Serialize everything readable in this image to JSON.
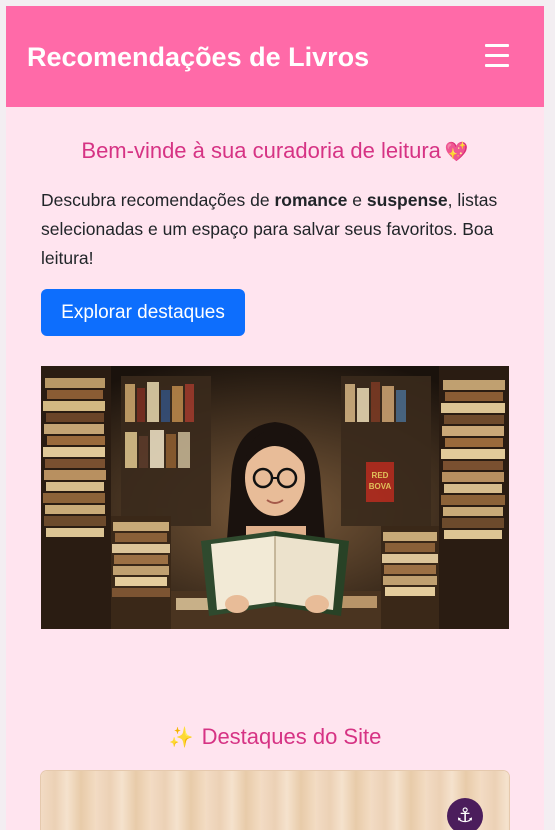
{
  "navbar": {
    "brand": "Recomendações de Livros",
    "menu_icon": "hamburger-menu-icon"
  },
  "welcome": {
    "title": "Bem-vinde à sua curadoria de leitura",
    "title_icon": "💖",
    "intro_prefix": "Descubra recomendações de ",
    "intro_bold_1": "romance",
    "intro_mid": " e ",
    "intro_bold_2": "suspense",
    "intro_suffix": ", listas selecionadas e um espaço para salvar seus favoritos. Boa leitura!",
    "cta_label": "Explorar destaques"
  },
  "hero_image": {
    "subject": "woman-reading-among-book-stacks",
    "book_title": "RED BOVA"
  },
  "highlights": {
    "icon": "✨",
    "title": "Destaques do Site",
    "card_icon": "anchor-icon"
  },
  "colors": {
    "navbar": "#ff6aa8",
    "page_background": "#ffe4ef",
    "heading": "#d63384",
    "button": "#0d6efd",
    "text": "#212529"
  }
}
